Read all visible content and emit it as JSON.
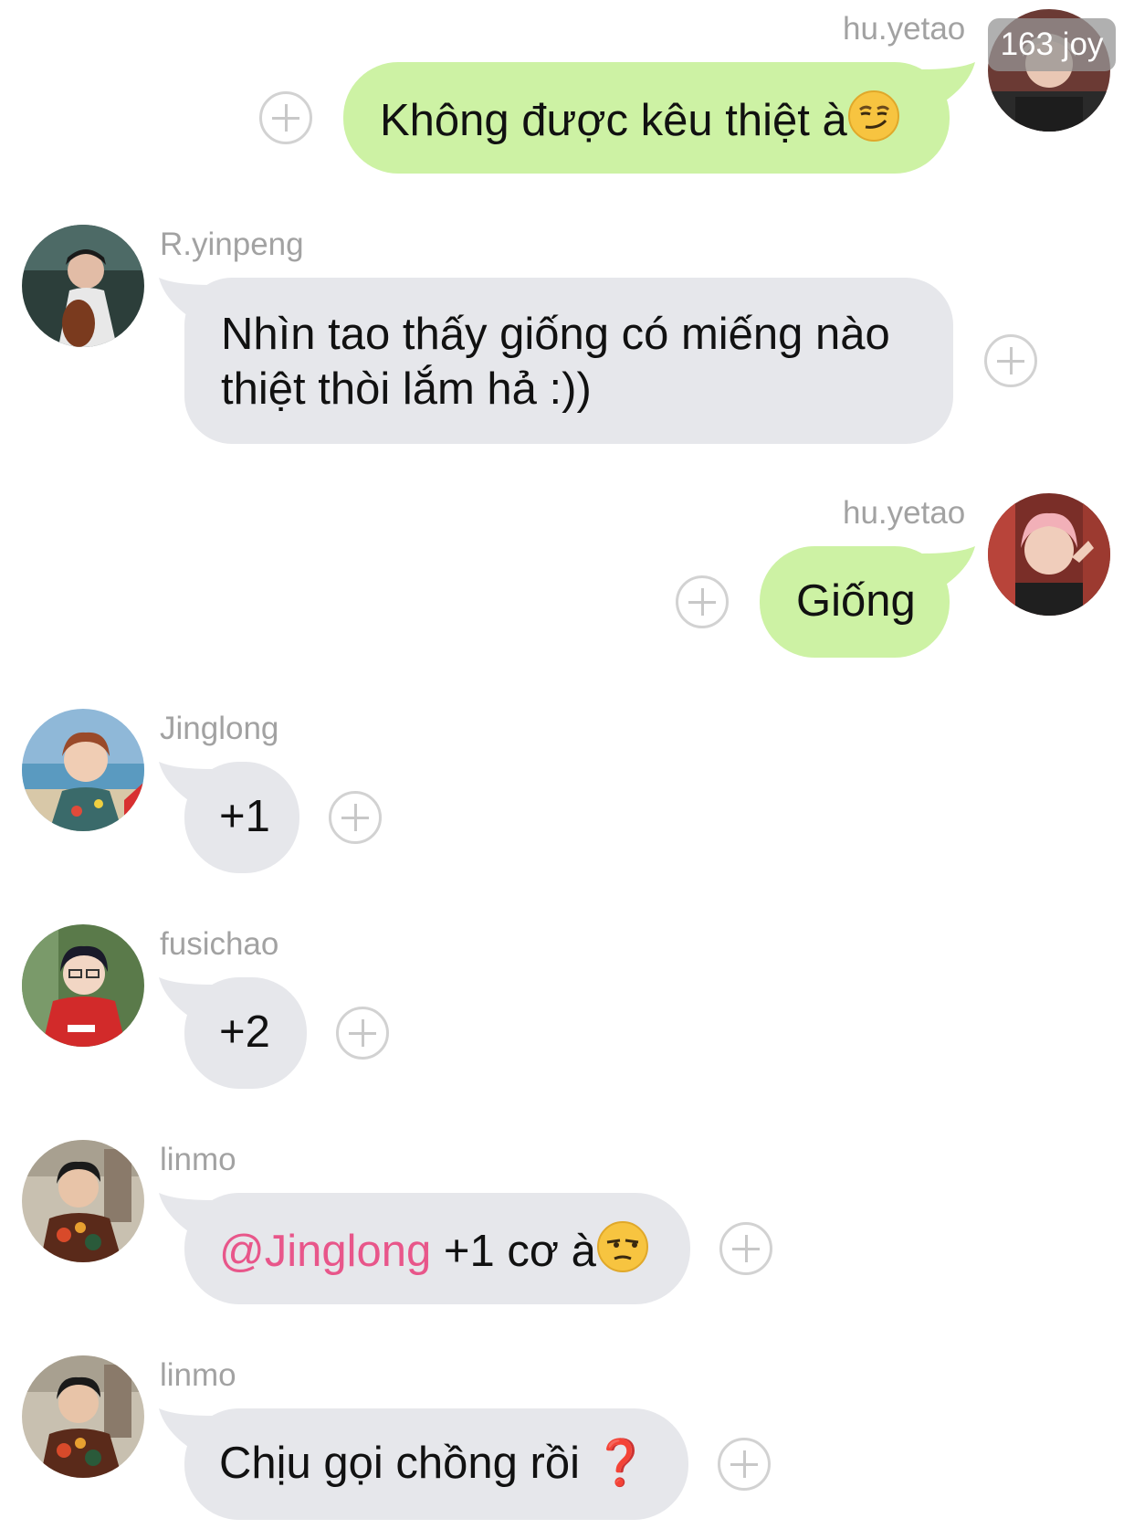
{
  "overlay": {
    "watermark": "163 joy"
  },
  "colors": {
    "outgoing_bubble": "#cdf2a4",
    "incoming_bubble": "#e6e7eb",
    "mention": "#e8568a",
    "username": "#a2a2a2"
  },
  "messages": [
    {
      "sender": "hu.yetao",
      "direction": "outgoing",
      "text": "Không được kêu thiệt à",
      "emoji": "smirking-face"
    },
    {
      "sender": "R.yinpeng",
      "direction": "incoming",
      "lines": [
        "Nhìn tao thấy giống có miếng nào",
        "thiệt thòi lắm hả :))"
      ]
    },
    {
      "sender": "hu.yetao",
      "direction": "outgoing",
      "text": "Giống"
    },
    {
      "sender": "Jinglong",
      "direction": "incoming",
      "text": "+1"
    },
    {
      "sender": "fusichao",
      "direction": "incoming",
      "text": "+2"
    },
    {
      "sender": "linmo",
      "direction": "incoming",
      "mention": "@Jinglong",
      "text": " +1 cơ à",
      "emoji": "unamused-face"
    },
    {
      "sender": "linmo",
      "direction": "incoming",
      "text": "Chịu gọi chồng rồi",
      "suffix": "❓"
    }
  ]
}
